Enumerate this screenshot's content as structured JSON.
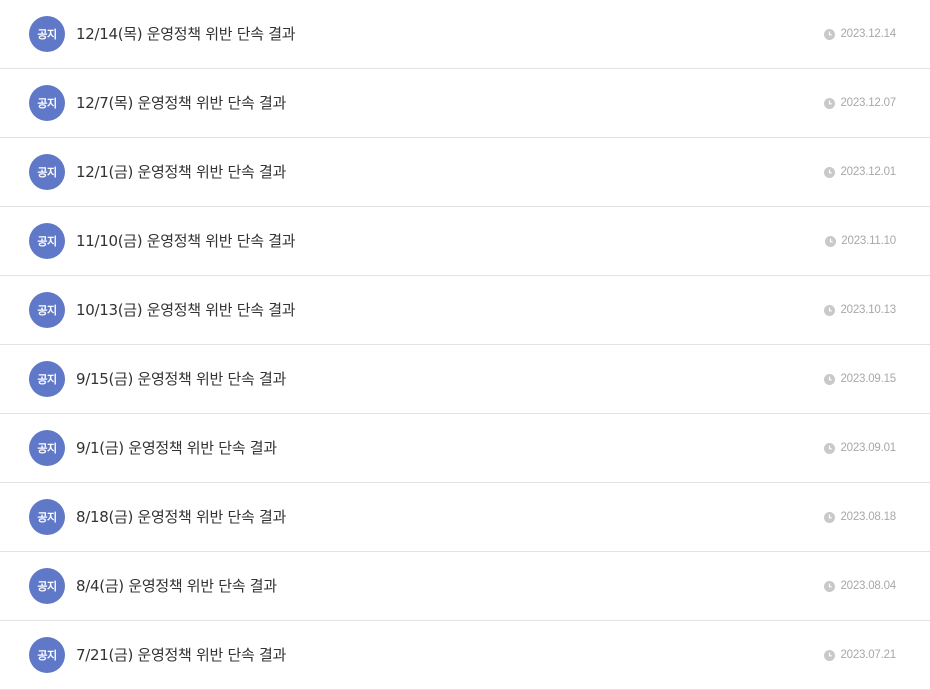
{
  "notices": [
    {
      "badge": "공지",
      "title": "12/14(목) 운영정책 위반 단속 결과",
      "date": "2023.12.14"
    },
    {
      "badge": "공지",
      "title": "12/7(목) 운영정책 위반 단속 결과",
      "date": "2023.12.07"
    },
    {
      "badge": "공지",
      "title": "12/1(금) 운영정책 위반 단속 결과",
      "date": "2023.12.01"
    },
    {
      "badge": "공지",
      "title": "11/10(금) 운영정책 위반 단속 결과",
      "date": "2023.11.10"
    },
    {
      "badge": "공지",
      "title": "10/13(금) 운영정책 위반 단속 결과",
      "date": "2023.10.13"
    },
    {
      "badge": "공지",
      "title": "9/15(금) 운영정책 위반 단속 결과",
      "date": "2023.09.15"
    },
    {
      "badge": "공지",
      "title": "9/1(금) 운영정책 위반 단속 결과",
      "date": "2023.09.01"
    },
    {
      "badge": "공지",
      "title": "8/18(금) 운영정책 위반 단속 결과",
      "date": "2023.08.18"
    },
    {
      "badge": "공지",
      "title": "8/4(금) 운영정책 위반 단속 결과",
      "date": "2023.08.04"
    },
    {
      "badge": "공지",
      "title": "7/21(금) 운영정책 위반 단속 결과",
      "date": "2023.07.21"
    }
  ],
  "icons": {
    "date": "clock-icon"
  },
  "colors": {
    "badge_bg": "#6078c8",
    "badge_text": "#ffffff",
    "title": "#333333",
    "date": "#a8a8a8",
    "divider": "#e3e3e3"
  }
}
